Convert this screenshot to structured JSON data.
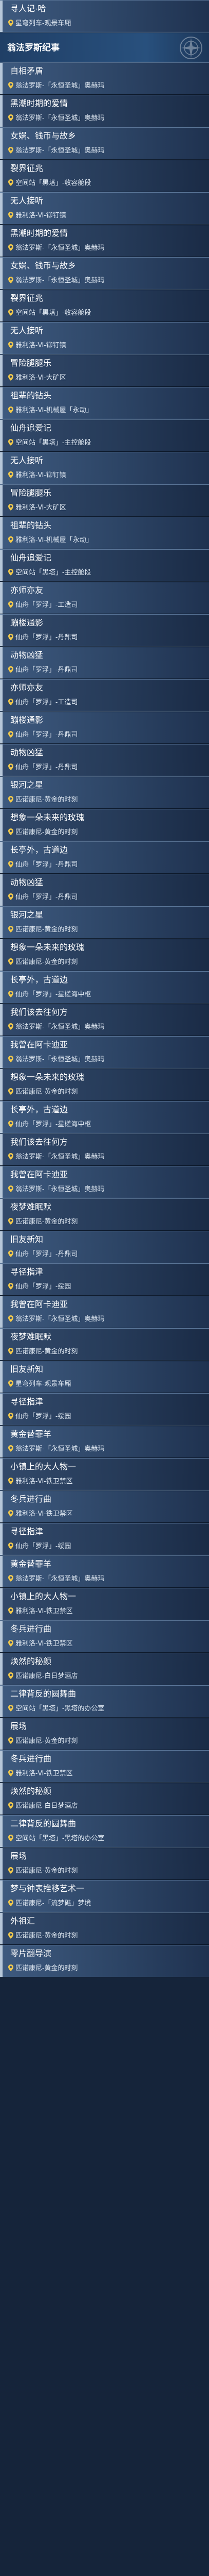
{
  "header": {
    "title": "翁法罗斯纪事",
    "emblem_icon": "compass-emblem-icon"
  },
  "cards": [
    {
      "title": "寻人记·哈",
      "location": "星穹列车-观景车厢"
    },
    {
      "header": true
    },
    {
      "title": "自相矛盾",
      "location": "翁法罗斯-「永恒圣城」奥赫玛"
    },
    {
      "title": "黑潮时期的爱情",
      "location": "翁法罗斯-「永恒圣城」奥赫玛"
    },
    {
      "title": "女娲、钱币与故乡",
      "location": "翁法罗斯-「永恒圣城」奥赫玛"
    },
    {
      "title": "裂界征兆",
      "location": "空间站「黑塔」-收容舱段"
    },
    {
      "title": "无人接听",
      "location": "雅利洛-Ⅵ-铆钉镇"
    },
    {
      "title": "黑潮时期的爱情",
      "location": "翁法罗斯-「永恒圣城」奥赫玛"
    },
    {
      "title": "女娲、钱币与故乡",
      "location": "翁法罗斯-「永恒圣城」奥赫玛"
    },
    {
      "title": "裂界征兆",
      "location": "空间站「黑塔」-收容舱段"
    },
    {
      "title": "无人接听",
      "location": "雅利洛-Ⅵ-铆钉镇"
    },
    {
      "title": "冒险腿腿乐",
      "location": "雅利洛-Ⅵ-大矿区"
    },
    {
      "title": "祖辈的钻头",
      "location": "雅利洛-Ⅵ-机械屋「永动」"
    },
    {
      "title": "仙舟追爱记",
      "location": "空间站「黑塔」-主控舱段"
    },
    {
      "title": "无人接听",
      "location": "雅利洛-Ⅵ-铆钉镇"
    },
    {
      "title": "冒险腿腿乐",
      "location": "雅利洛-Ⅵ-大矿区"
    },
    {
      "title": "祖辈的钻头",
      "location": "雅利洛-Ⅵ-机械屋「永动」"
    },
    {
      "title": "仙舟追爱记",
      "location": "空间站「黑塔」-主控舱段"
    },
    {
      "title": "亦师亦友",
      "location": "仙舟「罗浮」-工造司"
    },
    {
      "title": "蹦楼通影",
      "location": "仙舟「罗浮」-丹鼎司"
    },
    {
      "title": "动物凶猛",
      "location": "仙舟「罗浮」-丹鼎司"
    },
    {
      "title": "亦师亦友",
      "location": "仙舟「罗浮」-工造司"
    },
    {
      "title": "蹦楼通影",
      "location": "仙舟「罗浮」-丹鼎司"
    },
    {
      "title": "动物凶猛",
      "location": "仙舟「罗浮」-丹鼎司"
    },
    {
      "title": "银河之星",
      "location": "匹诺康尼-黄金的时刻"
    },
    {
      "title": "想象一朵未来的玫瑰",
      "location": "匹诺康尼-黄金的时刻"
    },
    {
      "title": "长亭外，古道边",
      "location": "仙舟「罗浮」-丹鼎司"
    },
    {
      "title": "动物凶猛",
      "location": "仙舟「罗浮」-丹鼎司"
    },
    {
      "title": "银河之星",
      "location": "匹诺康尼-黄金的时刻"
    },
    {
      "title": "想象一朵未来的玫瑰",
      "location": "匹诺康尼-黄金的时刻"
    },
    {
      "title": "长亭外，古道边",
      "location": "仙舟「罗浮」-星槎海中枢"
    },
    {
      "title": "我们该去往何方",
      "location": "翁法罗斯-「永恒圣城」奥赫玛"
    },
    {
      "title": "我曾在阿卡迪亚",
      "location": "翁法罗斯-「永恒圣城」奥赫玛"
    },
    {
      "title": "想象一朵未来的玫瑰",
      "location": "匹诺康尼-黄金的时刻"
    },
    {
      "title": "长亭外，古道边",
      "location": "仙舟「罗浮」-星槎海中枢"
    },
    {
      "title": "我们该去往何方",
      "location": "翁法罗斯-「永恒圣城」奥赫玛"
    },
    {
      "title": "我曾在阿卡迪亚",
      "location": "翁法罗斯-「永恒圣城」奥赫玛"
    },
    {
      "title": "夜梦难眠默",
      "location": "匹诺康尼-黄金的时刻"
    },
    {
      "title": "旧友新知",
      "location": "仙舟「罗浮」-丹鼎司"
    },
    {
      "title": "寻径指津",
      "location": "仙舟「罗浮」-绥园"
    },
    {
      "title": "我曾在阿卡迪亚",
      "location": "翁法罗斯-「永恒圣城」奥赫玛"
    },
    {
      "title": "夜梦难眠默",
      "location": "匹诺康尼-黄金的时刻"
    },
    {
      "title": "旧友新知",
      "location": "星穹列车-观景车厢"
    },
    {
      "title": "寻径指津",
      "location": "仙舟「罗浮」-绥园"
    },
    {
      "title": "黄金替罪羊",
      "location": "翁法罗斯-「永恒圣城」奥赫玛"
    },
    {
      "title": "小镇上的大人物一",
      "location": "雅利洛-Ⅵ-铁卫禁区"
    },
    {
      "title": "冬兵进行曲",
      "location": "雅利洛-Ⅵ-铁卫禁区"
    },
    {
      "title": "寻径指津",
      "location": "仙舟「罗浮」-绥园"
    },
    {
      "title": "黄金替罪羊",
      "location": "翁法罗斯-「永恒圣城」奥赫玛"
    },
    {
      "title": "小镇上的大人物一",
      "location": "雅利洛-Ⅵ-铁卫禁区"
    },
    {
      "title": "冬兵进行曲",
      "location": "雅利洛-Ⅵ-铁卫禁区"
    },
    {
      "title": "焕然的秘颜",
      "location": "匹诺康尼-白日梦酒店"
    },
    {
      "title": "二律背反的圆舞曲",
      "location": "空间站「黑塔」-黑塔的办公室"
    },
    {
      "title": "展场",
      "location": "匹诺康尼-黄金的时刻"
    },
    {
      "title": "冬兵进行曲",
      "location": "雅利洛-Ⅵ-铁卫禁区"
    },
    {
      "title": "焕然的秘颜",
      "location": "匹诺康尼-白日梦酒店"
    },
    {
      "title": "二律背反的圆舞曲",
      "location": "空间站「黑塔」-黑塔的办公室"
    },
    {
      "title": "展场",
      "location": "匹诺康尼-黄金的时刻"
    },
    {
      "title": "梦与钟表推移艺术一",
      "location": "匹诺康尼-「流梦礁」梦境"
    },
    {
      "title": "外祖汇",
      "location": "匹诺康尼-黄金的时刻"
    },
    {
      "title": "零片翻导演",
      "location": "匹诺康尼-黄金的时刻"
    }
  ]
}
